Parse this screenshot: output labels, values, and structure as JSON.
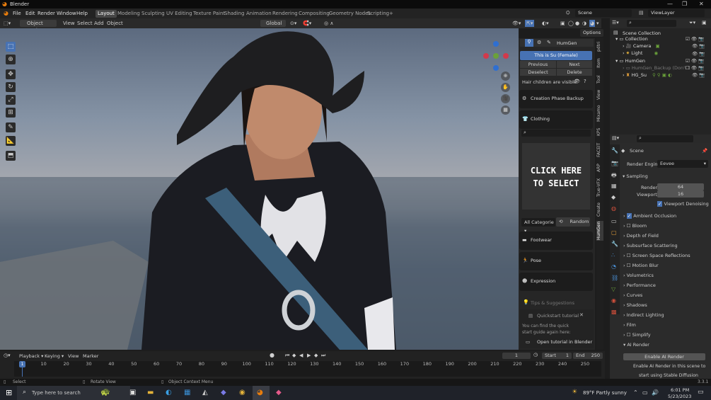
{
  "window": {
    "title": "Blender"
  },
  "menu": [
    "File",
    "Edit",
    "Render",
    "Window",
    "Help"
  ],
  "workspaces": [
    "Layout",
    "Modeling",
    "Sculpting",
    "UV Editing",
    "Texture Paint",
    "Shading",
    "Animation",
    "Rendering",
    "Compositing",
    "Geometry Nodes",
    "Scripting",
    "+"
  ],
  "scene_name": "Scene",
  "view_layer": "ViewLayer",
  "header": {
    "mode": "Object Mode",
    "menus": [
      "View",
      "Select",
      "Add",
      "Object"
    ],
    "orientation": "Global",
    "options": "Options"
  },
  "gizmo_axes": [
    "X",
    "Y",
    "Z"
  ],
  "humgen": {
    "tab_title": "HumGen",
    "selected_human": "This is Su (Female)",
    "previous": "Previous",
    "next": "Next",
    "deselect": "Deselect",
    "delete": "Delete",
    "hair_children": "Hair children are visible",
    "creation_backup": "Creation Phase Backup",
    "clothing": "Clothing",
    "click_here": "CLICK HERE TO SELECT",
    "all_categories": "All Categorie",
    "random": "Random",
    "footwear": "Footwear",
    "pose": "Pose",
    "expression": "Expression",
    "tips": "Tips & Suggestions",
    "quickstart_title": "Quickstart tutorial",
    "quickstart_text": "You can find the quick start guide again here:",
    "open_tutorial": "Open tutorial in Blender"
  },
  "side_tabs": [
    "pdtri",
    "Item",
    "Tool",
    "View",
    "Mixamo",
    "KPS",
    "FACEIT",
    "ARP",
    "True-VFX",
    "Create",
    "HumGen"
  ],
  "outliner": {
    "title": "Scene Collection",
    "rows": [
      {
        "label": "Collection",
        "indent": 1
      },
      {
        "label": "Camera",
        "indent": 2
      },
      {
        "label": "Light",
        "indent": 2
      },
      {
        "label": "HumGen",
        "indent": 1
      },
      {
        "label": "HumGen_Backup (Don't t",
        "indent": 2
      },
      {
        "label": "HG_Su",
        "indent": 2
      }
    ]
  },
  "properties": {
    "scene": "Scene",
    "render_engine_label": "Render Engine",
    "render_engine": "Eevee",
    "sampling": "Sampling",
    "render_label": "Render",
    "render_value": "64",
    "viewport_label": "Viewport",
    "viewport_value": "16",
    "viewport_denoising": "Viewport Denoising",
    "panels": [
      "Ambient Occlusion",
      "Bloom",
      "Depth of Field",
      "Subsurface Scattering",
      "Screen Space Reflections",
      "Motion Blur",
      "Volumetrics",
      "Performance",
      "Curves",
      "Shadows",
      "Indirect Lighting",
      "Film",
      "Simplify",
      "AI Render"
    ],
    "enable_ai_render": "Enable AI Render",
    "ai_text_1": "Enable AI Render in this scene to",
    "ai_text_2": "start using Stable Diffusion"
  },
  "timeline": {
    "menus": [
      "Playback",
      "Keying",
      "View",
      "Marker"
    ],
    "current_frame": "1",
    "start_label": "Start",
    "start": "1",
    "end_label": "End",
    "end": "250",
    "ticks": [
      "1",
      "10",
      "20",
      "30",
      "40",
      "50",
      "60",
      "70",
      "80",
      "90",
      "100",
      "110",
      "120",
      "130",
      "140",
      "150",
      "160",
      "170",
      "180",
      "190",
      "200",
      "210",
      "220",
      "230",
      "240",
      "250"
    ]
  },
  "status": {
    "select": "Select",
    "rotate": "Rotate View",
    "context": "Object Context Menu",
    "version": "3.3.1"
  },
  "taskbar": {
    "search": "Type here to search",
    "weather": "89°F  Partly sunny",
    "time": "6:01 PM",
    "date": "5/23/2023"
  }
}
